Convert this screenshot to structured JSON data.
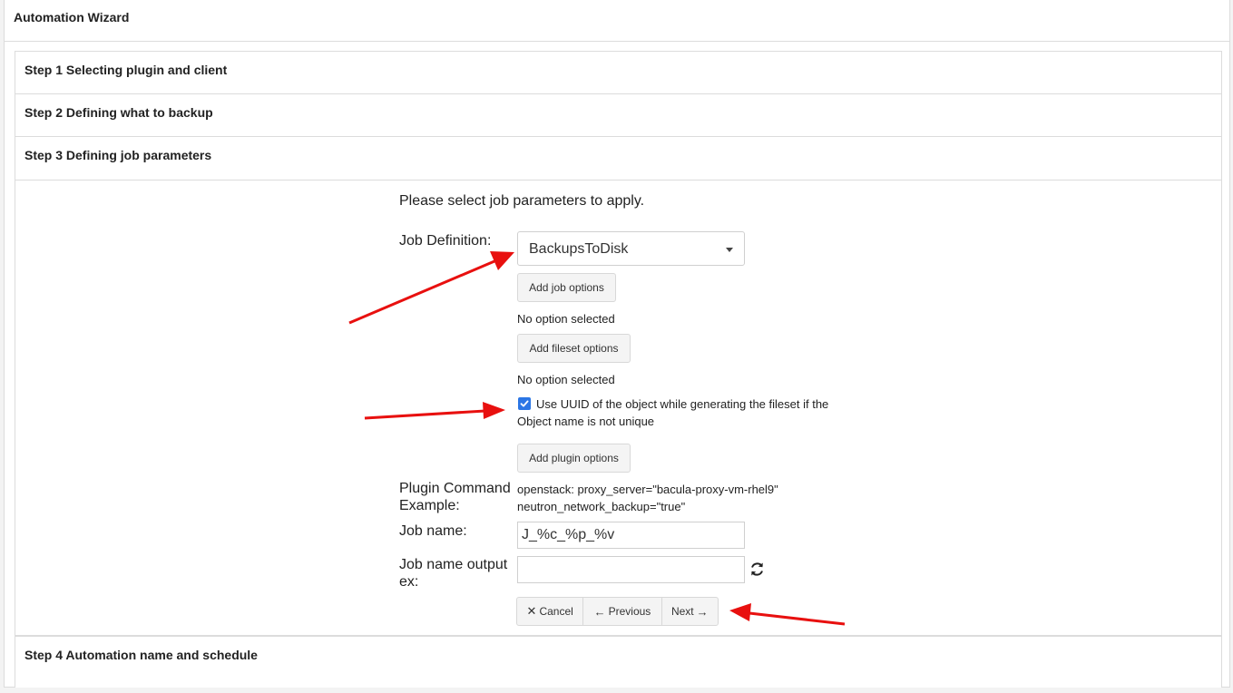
{
  "header": {
    "title": "Automation Wizard"
  },
  "steps": [
    {
      "title": "Step 1 Selecting plugin and client"
    },
    {
      "title": "Step 2 Defining what to backup"
    },
    {
      "title": "Step 3 Defining job parameters"
    },
    {
      "title": "Step 4 Automation name and schedule"
    }
  ],
  "step3": {
    "intro": "Please select job parameters to apply.",
    "job_definition_label": "Job Definition:",
    "job_definition_value": "BackupsToDisk",
    "add_job_options": "Add job options",
    "job_options_status": "No option selected",
    "add_fileset_options": "Add fileset options",
    "fileset_options_status": "No option selected",
    "uuid_checkbox_label": "Use UUID of the object while generating the fileset if the Object name is not unique",
    "uuid_checked": true,
    "add_plugin_options": "Add plugin options",
    "plugin_command_label": "Plugin Command Example:",
    "plugin_command_value": "openstack: proxy_server=\"bacula-proxy-vm-rhel9\" neutron_network_backup=\"true\"",
    "job_name_label": "Job name:",
    "job_name_value": "J_%c_%p_%v",
    "job_name_output_label": "Job name output ex:",
    "job_name_output_value": "",
    "refresh_icon": "refresh-icon",
    "nav": {
      "cancel": "Cancel",
      "previous": "Previous",
      "next": "Next"
    }
  },
  "colors": {
    "annotation_arrow": "#e8100f",
    "checkbox": "#2b76e5",
    "border": "#dcdcdc"
  }
}
